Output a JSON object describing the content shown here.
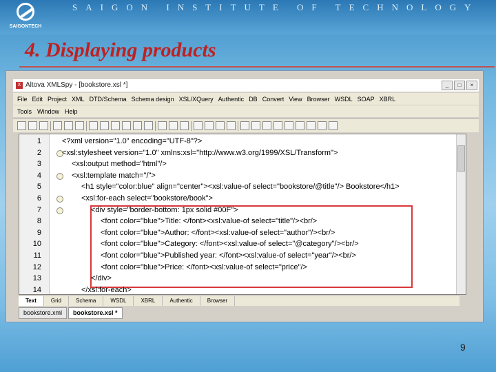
{
  "brand": {
    "logo_text": "SAIGONTECH",
    "org": "SAIGON INSTITUTE OF TECHNOLOGY"
  },
  "slide": {
    "title": "4. Displaying products",
    "page": "9"
  },
  "window": {
    "title": "Altova XMLSpy - [bookstore.xsl *]",
    "buttons": [
      "_",
      "□",
      "×"
    ]
  },
  "menu": {
    "row1": [
      "File",
      "Edit",
      "Project",
      "XML",
      "DTD/Schema",
      "Schema design",
      "XSL/XQuery",
      "Authentic",
      "DB",
      "Convert",
      "View",
      "Browser",
      "WSDL",
      "SOAP",
      "XBRL"
    ],
    "row2": [
      "Tools",
      "Window",
      "Help"
    ]
  },
  "code_lines": [
    {
      "n": "1",
      "t": "<?xml version=\"1.0\" encoding=\"UTF-8\"?>",
      "i": 0
    },
    {
      "n": "2",
      "t": "<xsl:stylesheet version=\"1.0\" xmlns:xsl=\"http://www.w3.org/1999/XSL/Transform\">",
      "i": 0
    },
    {
      "n": "3",
      "t": "<xsl:output method=\"html\"/>",
      "i": 1
    },
    {
      "n": "4",
      "t": "<xsl:template match=\"/\">",
      "i": 1
    },
    {
      "n": "5",
      "t": "<h1 style=\"color:blue\" align=\"center\"><xsl:value-of select=\"bookstore/@title\"/> Bookstore</h1>",
      "i": 2
    },
    {
      "n": "6",
      "t": "<xsl:for-each select=\"bookstore/book\">",
      "i": 2
    },
    {
      "n": "7",
      "t": "<div style=\"border-bottom: 1px solid #00F\">",
      "i": 3
    },
    {
      "n": "8",
      "t": "<font color=\"blue\">Title: </font><xsl:value-of select=\"title\"/><br/>",
      "i": 4
    },
    {
      "n": "9",
      "t": "<font color=\"blue\">Author: </font><xsl:value-of select=\"author\"/><br/>",
      "i": 4
    },
    {
      "n": "10",
      "t": "<font color=\"blue\">Category: </font><xsl:value-of select=\"@category\"/><br/>",
      "i": 4
    },
    {
      "n": "11",
      "t": "<font color=\"blue\">Published year: </font><xsl:value-of select=\"year\"/><br/>",
      "i": 4
    },
    {
      "n": "12",
      "t": "<font color=\"blue\">Price: </font><xsl:value-of select=\"price\"/>",
      "i": 4
    },
    {
      "n": "13",
      "t": "</div>",
      "i": 3
    },
    {
      "n": "14",
      "t": "</xsl:for-each>",
      "i": 2
    }
  ],
  "view_tabs": [
    "Text",
    "Grid",
    "Schema",
    "WSDL",
    "XBRL",
    "Authentic",
    "Browser"
  ],
  "doc_tabs": [
    "bookstore.xml",
    "bookstore.xsl *"
  ]
}
